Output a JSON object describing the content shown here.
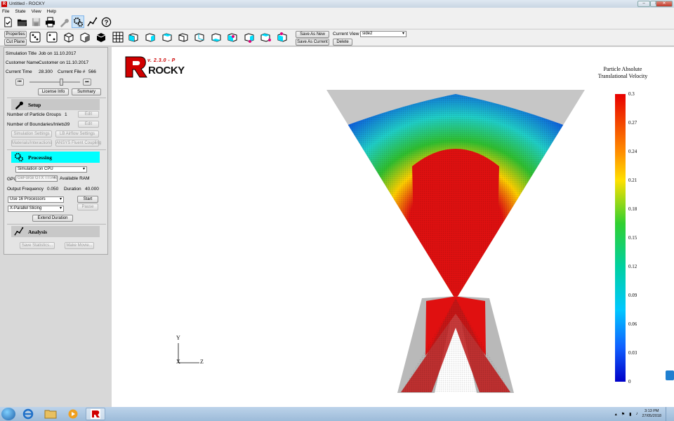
{
  "window": {
    "title": "Untitled - ROCKY",
    "logo_letter": "R"
  },
  "menu": [
    "File",
    "State",
    "View",
    "Help"
  ],
  "toolbar": {
    "properties_label": "Properties",
    "cut_plane_label": "Cut Plane",
    "save_as_new_label": "Save As New",
    "save_as_current_label": "Save As Current",
    "current_view_label": "Current View",
    "current_view_value": "side2",
    "delete_label": "Delete"
  },
  "simulation": {
    "title_label": "Simulation Title",
    "title_value": "Job on 11.10.2017",
    "customer_label": "Customer Name",
    "customer_value": "Customer on 11.10.2017",
    "current_time_label": "Current Time",
    "current_time_value": "28.300",
    "current_file_label": "Current File #",
    "current_file_value": "566",
    "license_info_label": "License Info",
    "summary_label": "Summary"
  },
  "setup": {
    "header": "Setup",
    "particle_groups_label": "Number of Particle Groups",
    "particle_groups_value": "1",
    "boundaries_label": "Number of Boundaries/Inlets",
    "boundaries_value": "39",
    "edit_label": "Edit",
    "simulation_settings_label": "Simulation Settings",
    "lb_airflow_label": "LB Airflow Settings",
    "materials_label": "Materials/Interactions",
    "ansys_label": "ANSYS Fluent Coupling"
  },
  "processing": {
    "header": "Processing",
    "mode_value": "Simulation on CPU",
    "gpu_label": "GPU",
    "gpu_value": "GeForce GTX TITAN",
    "available_ram_label": "Available RAM",
    "output_freq_label": "Output Frequency",
    "output_freq_value": "0.050",
    "duration_label": "Duration",
    "duration_value": "40.000",
    "processors_value": "Use 16 Processors",
    "slicing_value": "X-Parallel Slicing",
    "start_label": "Start",
    "pause_label": "Pause",
    "extend_label": "Extend Duration"
  },
  "analysis": {
    "header": "Analysis",
    "save_stats_label": "Save Statistics...",
    "make_movie_label": "Make Movie..."
  },
  "logo": {
    "version": "v. 2.3.0 - P",
    "name": "ROCKY"
  },
  "colorbar": {
    "title_line1": "Particle Absolute",
    "title_line2": "Translational Velocity",
    "ticks": [
      "0.3",
      "0.27",
      "0.24",
      "0.21",
      "0.18",
      "0.15",
      "0.12",
      "0.09",
      "0.06",
      "0.03",
      "0"
    ]
  },
  "axes": {
    "y": "Y",
    "x": "X",
    "z": "Z"
  },
  "taskbar": {
    "time": "3:13 PM",
    "date": "27/05/2018"
  },
  "colors": {
    "accent_cyan": "#00ffff",
    "close_red": "#c0392b",
    "taskbar": "#9dbbd9"
  }
}
